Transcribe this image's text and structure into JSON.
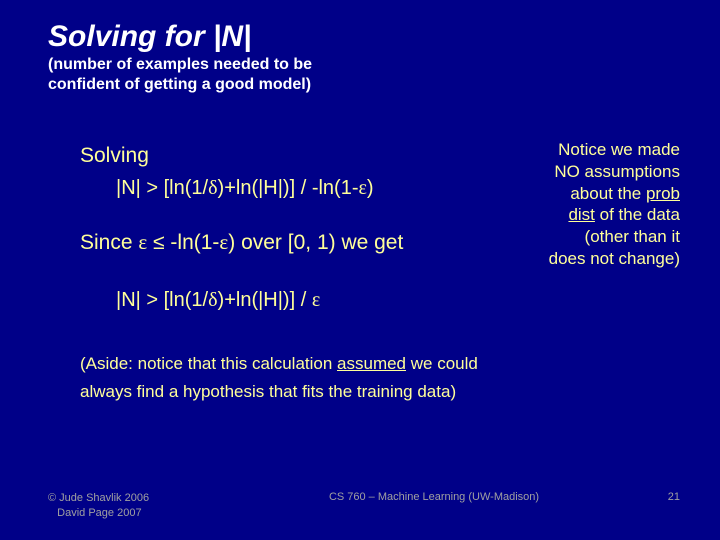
{
  "title": "Solving for |N|",
  "subtitle_l1": "(number of examples needed to be",
  "subtitle_l2": "confident of getting a good model)",
  "solving_label": "Solving",
  "eq1_pre": "|N| > [ln(1/",
  "eq1_delta": "δ",
  "eq1_mid": ")+ln(|H|)] / -ln(1-",
  "eq1_eps": "ε",
  "eq1_post": ")",
  "since_pre": "Since ",
  "since_eps1": "ε",
  "since_le": " ≤ ",
  "since_mid": "-ln(1-",
  "since_eps2": "ε",
  "since_post": ") over [0, 1) we get",
  "eq2_pre": "|N| > [ln(1/",
  "eq2_delta": "δ",
  "eq2_mid": ")+ln(|H|)] / ",
  "eq2_eps": "ε",
  "notice_l1": "Notice we made",
  "notice_l2": "NO assumptions",
  "notice_l3a": "about the ",
  "notice_l3b_u": "prob",
  "notice_l4a_u": "dist",
  "notice_l4b": " of the data",
  "notice_l5": "(other than it",
  "notice_l6": "does not change)",
  "aside_l1a": "(Aside: notice that this calculation ",
  "aside_l1b_u": "assumed",
  "aside_l1c": " we could",
  "aside_l2": "always find a hypothesis that fits the training data)",
  "footer_left_l1": "© Jude Shavlik 2006",
  "footer_left_l2": "   David Page 2007",
  "footer_center": "CS 760 – Machine Learning (UW-Madison)",
  "footer_right": "21"
}
